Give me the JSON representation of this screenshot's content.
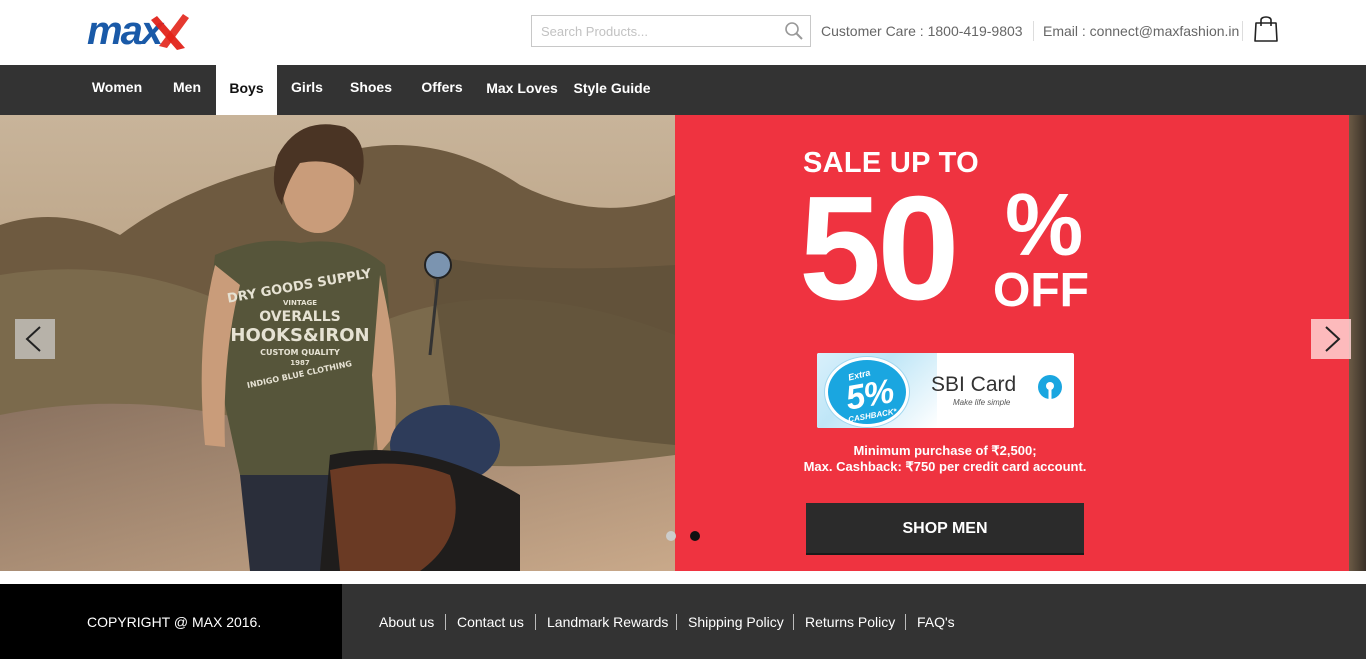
{
  "header": {
    "logo_text": "max",
    "search_placeholder": "Search Products...",
    "customer_care": "Customer Care : 1800-419-9803",
    "email": "Email : connect@maxfashion.in"
  },
  "nav": {
    "items": [
      {
        "label": "Women"
      },
      {
        "label": "Men"
      },
      {
        "label": "Boys",
        "active": true
      },
      {
        "label": "Girls"
      },
      {
        "label": "Shoes"
      },
      {
        "label": "Offers"
      },
      {
        "label": "Max Loves"
      },
      {
        "label": "Style Guide"
      }
    ]
  },
  "banner": {
    "photo_tshirt_text": [
      "DRY GOODS SUPPLY",
      "VINTAGE",
      "OVERALLS",
      "HOOKS&IRON",
      "CUSTOM QUALITY",
      "1987",
      "INDIGO BLUE CLOTHING"
    ],
    "sale_line": "SALE UP TO",
    "big_number": "50",
    "percent": "%",
    "off": "OFF",
    "sbi": {
      "extra": "Extra",
      "five": "5%",
      "cashback": "CASHBACK*",
      "name": "SBI Card",
      "tagline": "Make life simple"
    },
    "terms_line1": "Minimum purchase of ₹2,500;",
    "terms_line2": "Max. Cashback: ₹750 per credit card account.",
    "cta": "SHOP MEN",
    "slides_total": 2,
    "active_slide": 2
  },
  "footer": {
    "copyright": "COPYRIGHT @ MAX 2016.",
    "links": [
      "About us",
      "Contact us",
      "Landmark Rewards",
      "Shipping Policy",
      "Returns Policy",
      "FAQ's"
    ]
  },
  "colors": {
    "brand_blue": "#1a5aa8",
    "brand_red": "#e2231a",
    "nav_bg": "#333333",
    "promo_red": "#ef3340",
    "cta_bg": "#2b2b2b",
    "sbi_blue": "#1aa6e0"
  }
}
